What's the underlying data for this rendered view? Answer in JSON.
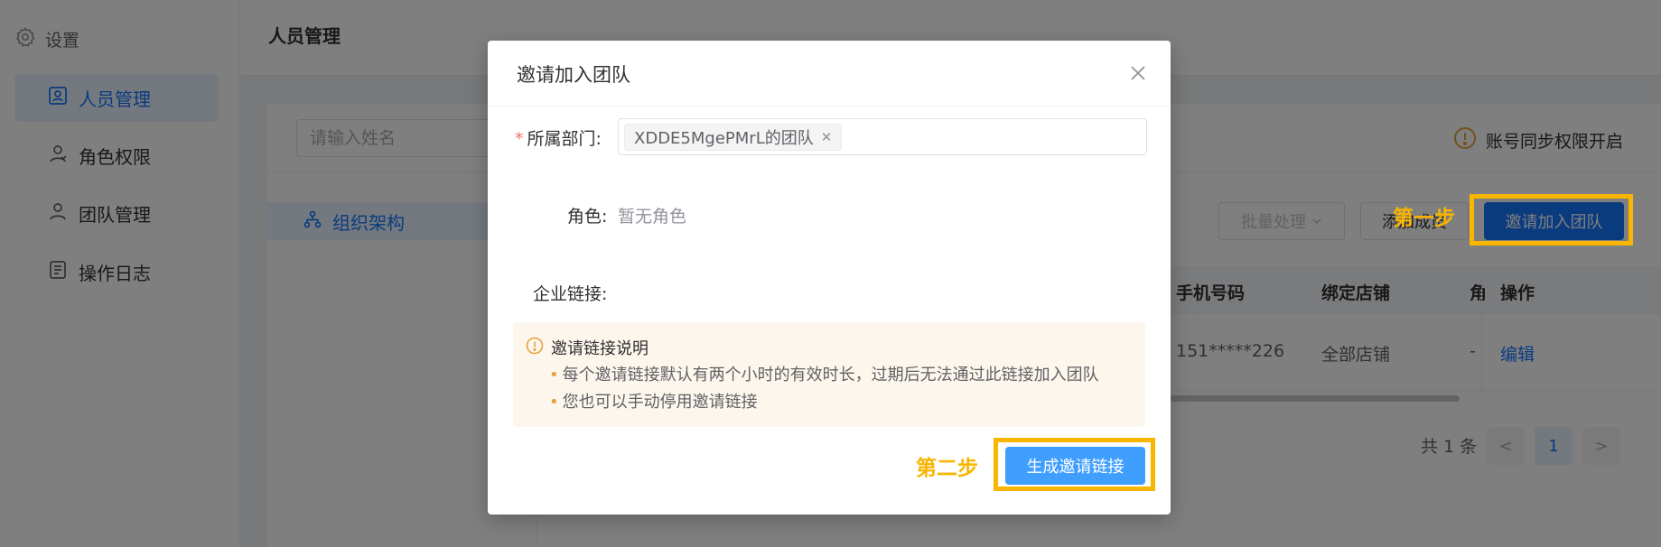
{
  "sidebar": {
    "settings_label": "设置",
    "items": [
      {
        "label": "人员管理",
        "icon": "user-card-icon",
        "active": true
      },
      {
        "label": "角色权限",
        "icon": "user-icon",
        "active": false
      },
      {
        "label": "团队管理",
        "icon": "user-icon",
        "active": false
      },
      {
        "label": "操作日志",
        "icon": "log-icon",
        "active": false
      }
    ]
  },
  "header": {
    "title": "人员管理"
  },
  "main": {
    "search_placeholder": "请输入姓名",
    "sync_label": "账号同步权限开启",
    "tree_root": "组织架构",
    "toolbar": {
      "batch_label": "批量处理",
      "add_member_label": "添加成员",
      "invite_label": "邀请加入团队"
    },
    "table": {
      "headers": [
        "手机号码",
        "绑定店铺",
        "角",
        "操作"
      ],
      "rows": [
        [
          "151*****226",
          "全部店铺",
          "-",
          "编辑"
        ]
      ]
    },
    "pagination": {
      "total": "共 1 条",
      "prev": "<",
      "current": "1",
      "next": ">"
    }
  },
  "annotations": {
    "step1": "第一步",
    "step2": "第二步",
    "highlight_color": "#f9b500"
  },
  "dialog": {
    "title": "邀请加入团队",
    "dept_label": "所属部门:",
    "dept_tag": "XDDE5MgePMrL的团队",
    "role_label": "角色:",
    "role_value": "暂无角色",
    "link_label": "企业链接:",
    "notice": {
      "title": "邀请链接说明",
      "items": [
        "每个邀请链接默认有两个小时的有效时长，过期后无法通过此链接加入团队",
        "您也可以手动停用邀请链接"
      ]
    },
    "generate_label": "生成邀请链接"
  },
  "colors": {
    "primary": "#1677ff",
    "button_blue": "#409eff",
    "warning": "#e6a23c",
    "required": "#f56c6c"
  }
}
